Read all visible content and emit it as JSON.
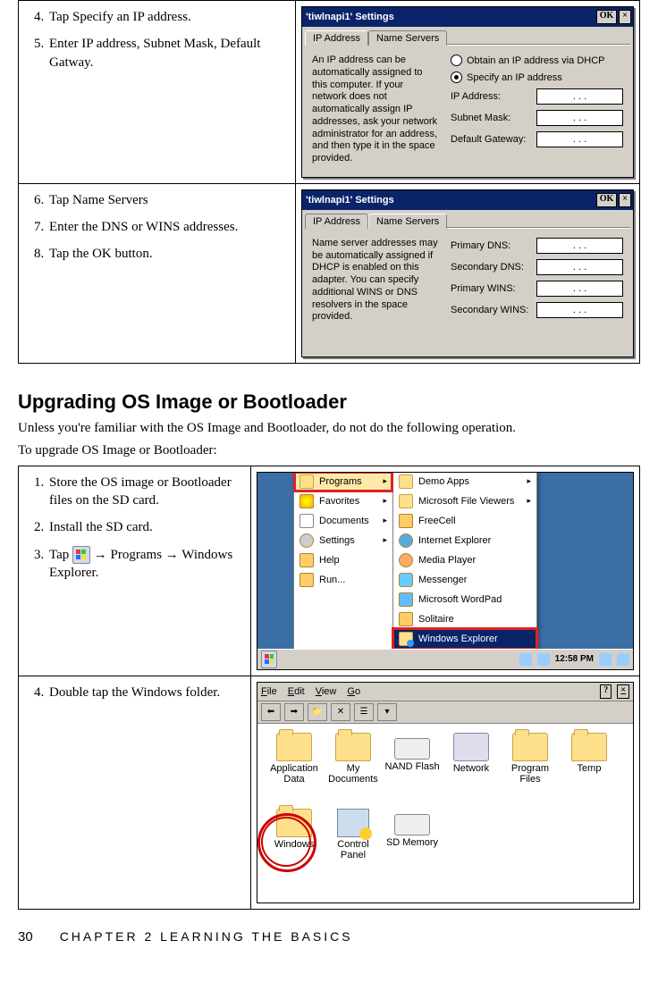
{
  "row1": {
    "steps": [
      {
        "n": "4.",
        "t": "Tap Specify an IP address."
      },
      {
        "n": "5.",
        "t": "Enter IP address, Subnet Mask, Default Gatway."
      }
    ],
    "dialog": {
      "title": "'tiwlnapi1' Settings",
      "ok": "OK",
      "close": "×",
      "tabs": [
        "IP Address",
        "Name Servers"
      ],
      "desc": "An IP address can be automatically assigned to this computer. If your network does not automatically assign IP addresses, ask your network administrator for an address, and then type it in the space provided.",
      "radio1": "Obtain an IP address via DHCP",
      "radio2": "Specify an IP address",
      "f1": "IP Address:",
      "f2": "Subnet Mask:",
      "f3": "Default Gateway:"
    }
  },
  "row2": {
    "steps": [
      {
        "n": "6.",
        "t": "Tap Name Servers"
      },
      {
        "n": "7.",
        "t": "Enter the DNS or WINS addresses."
      },
      {
        "n": "8.",
        "t": "Tap the OK button."
      }
    ],
    "dialog": {
      "title": "'tiwlnapi1' Settings",
      "ok": "OK",
      "close": "×",
      "tabs": [
        "IP Address",
        "Name Servers"
      ],
      "desc": "Name server addresses may be automatically assigned if DHCP is enabled on this adapter. You can specify additional WINS or DNS resolvers in the space provided.",
      "f1": "Primary DNS:",
      "f2": "Secondary DNS:",
      "f3": "Primary WINS:",
      "f4": "Secondary WINS:"
    }
  },
  "section": {
    "heading": "Upgrading OS Image or Bootloader",
    "p1": "Unless you're familiar with the OS Image and Bootloader, do not do the following operation.",
    "p2": "To upgrade OS Image or Bootloader:"
  },
  "row3": {
    "steps": [
      {
        "n": "1.",
        "t": "Store the OS image or Bootloader files on the SD card."
      },
      {
        "n": "2.",
        "t": "Install the SD card."
      },
      {
        "n": "3.",
        "t_pre": "Tap ",
        "t_post": " → Programs → Windows Explorer."
      }
    ],
    "startmenu": {
      "col1": [
        "Programs",
        "Favorites",
        "Documents",
        "Settings",
        "Help",
        "Run..."
      ],
      "col2": [
        "Demo Apps",
        "Microsoft File Viewers",
        "FreeCell",
        "Internet Explorer",
        "Media Player",
        "Messenger",
        "Microsoft WordPad",
        "Solitaire",
        "Windows Explorer"
      ],
      "time": "12:58 PM"
    }
  },
  "row4": {
    "steps": [
      {
        "n": "4.",
        "t": "Double tap the Windows folder."
      }
    ],
    "explorer": {
      "menus": [
        "File",
        "Edit",
        "View",
        "Go"
      ],
      "help": "?",
      "close": "×",
      "items": [
        "Application Data",
        "My Documents",
        "NAND Flash",
        "Network",
        "Program Files",
        "Temp",
        "Windows",
        "Control Panel",
        "SD Memory"
      ]
    }
  },
  "footer": {
    "page": "30",
    "chapter": "CHAPTER 2 LEARNING THE BASICS"
  },
  "ipdots": ".   .   ."
}
